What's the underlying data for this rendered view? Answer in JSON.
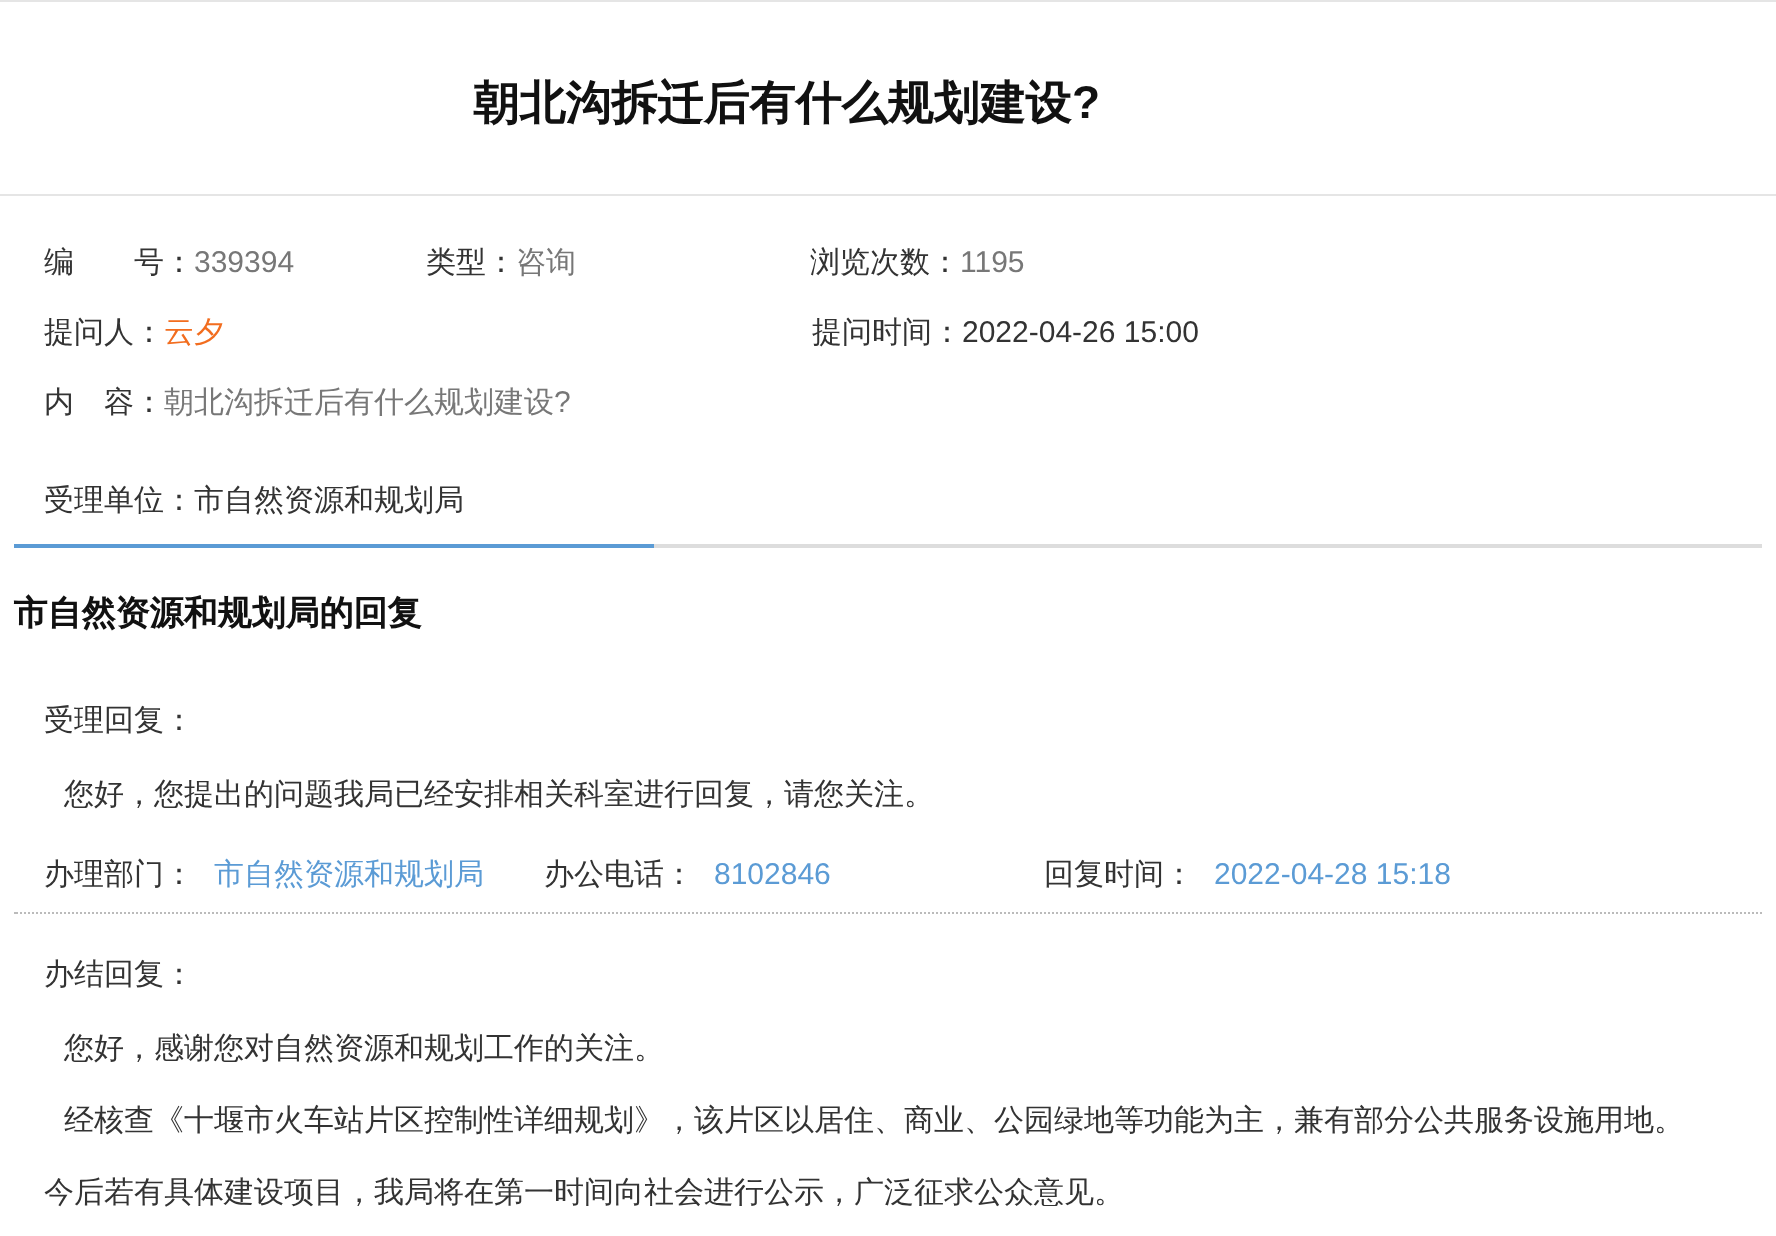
{
  "title": "朝北沟拆迁后有什么规划建设?",
  "info_rows": [
    [
      {
        "label": "编　　号：",
        "value": "339394",
        "kind": "plain"
      },
      {
        "label": "类型：",
        "value": "咨询",
        "kind": "plain"
      },
      {
        "label": "浏览次数：",
        "value": "1195",
        "kind": "plain"
      }
    ],
    [
      {
        "label": "提问人：",
        "value": "云夕",
        "kind": "highlight"
      },
      {
        "label": "提问时间：",
        "value": "2022-04-26 15:00",
        "kind": "dark"
      }
    ],
    [
      {
        "label": "内　容：",
        "value": "朝北沟拆迁后有什么规划建设?",
        "kind": "plain"
      }
    ],
    [
      {
        "label": "受理单位：",
        "value": "市自然资源和规划局",
        "kind": "dark"
      }
    ]
  ],
  "reply_heading": "市自然资源和规划局的回复",
  "acceptance": {
    "heading": "受理回复：",
    "paragraphs": [
      "您好，您提出的问题我局已经安排相关科室进行回复，请您关注。"
    ]
  },
  "meta": [
    {
      "label": "办理部门：",
      "value": "市自然资源和规划局"
    },
    {
      "label": "办公电话：",
      "value": "8102846"
    },
    {
      "label": "回复时间：",
      "value": "2022-04-28 15:18"
    }
  ],
  "final": {
    "heading": "办结回复：",
    "paragraphs": [
      "您好，感谢您对自然资源和规划工作的关注。",
      "经核查《十堰市火车站片区控制性详细规划》，该片区以居住、商业、公园绿地等功能为主，兼有部分公共服务设施用地。今后若有具体建设项目，我局将在第一时间向社会进行公示，广泛征求公众意见。"
    ]
  }
}
